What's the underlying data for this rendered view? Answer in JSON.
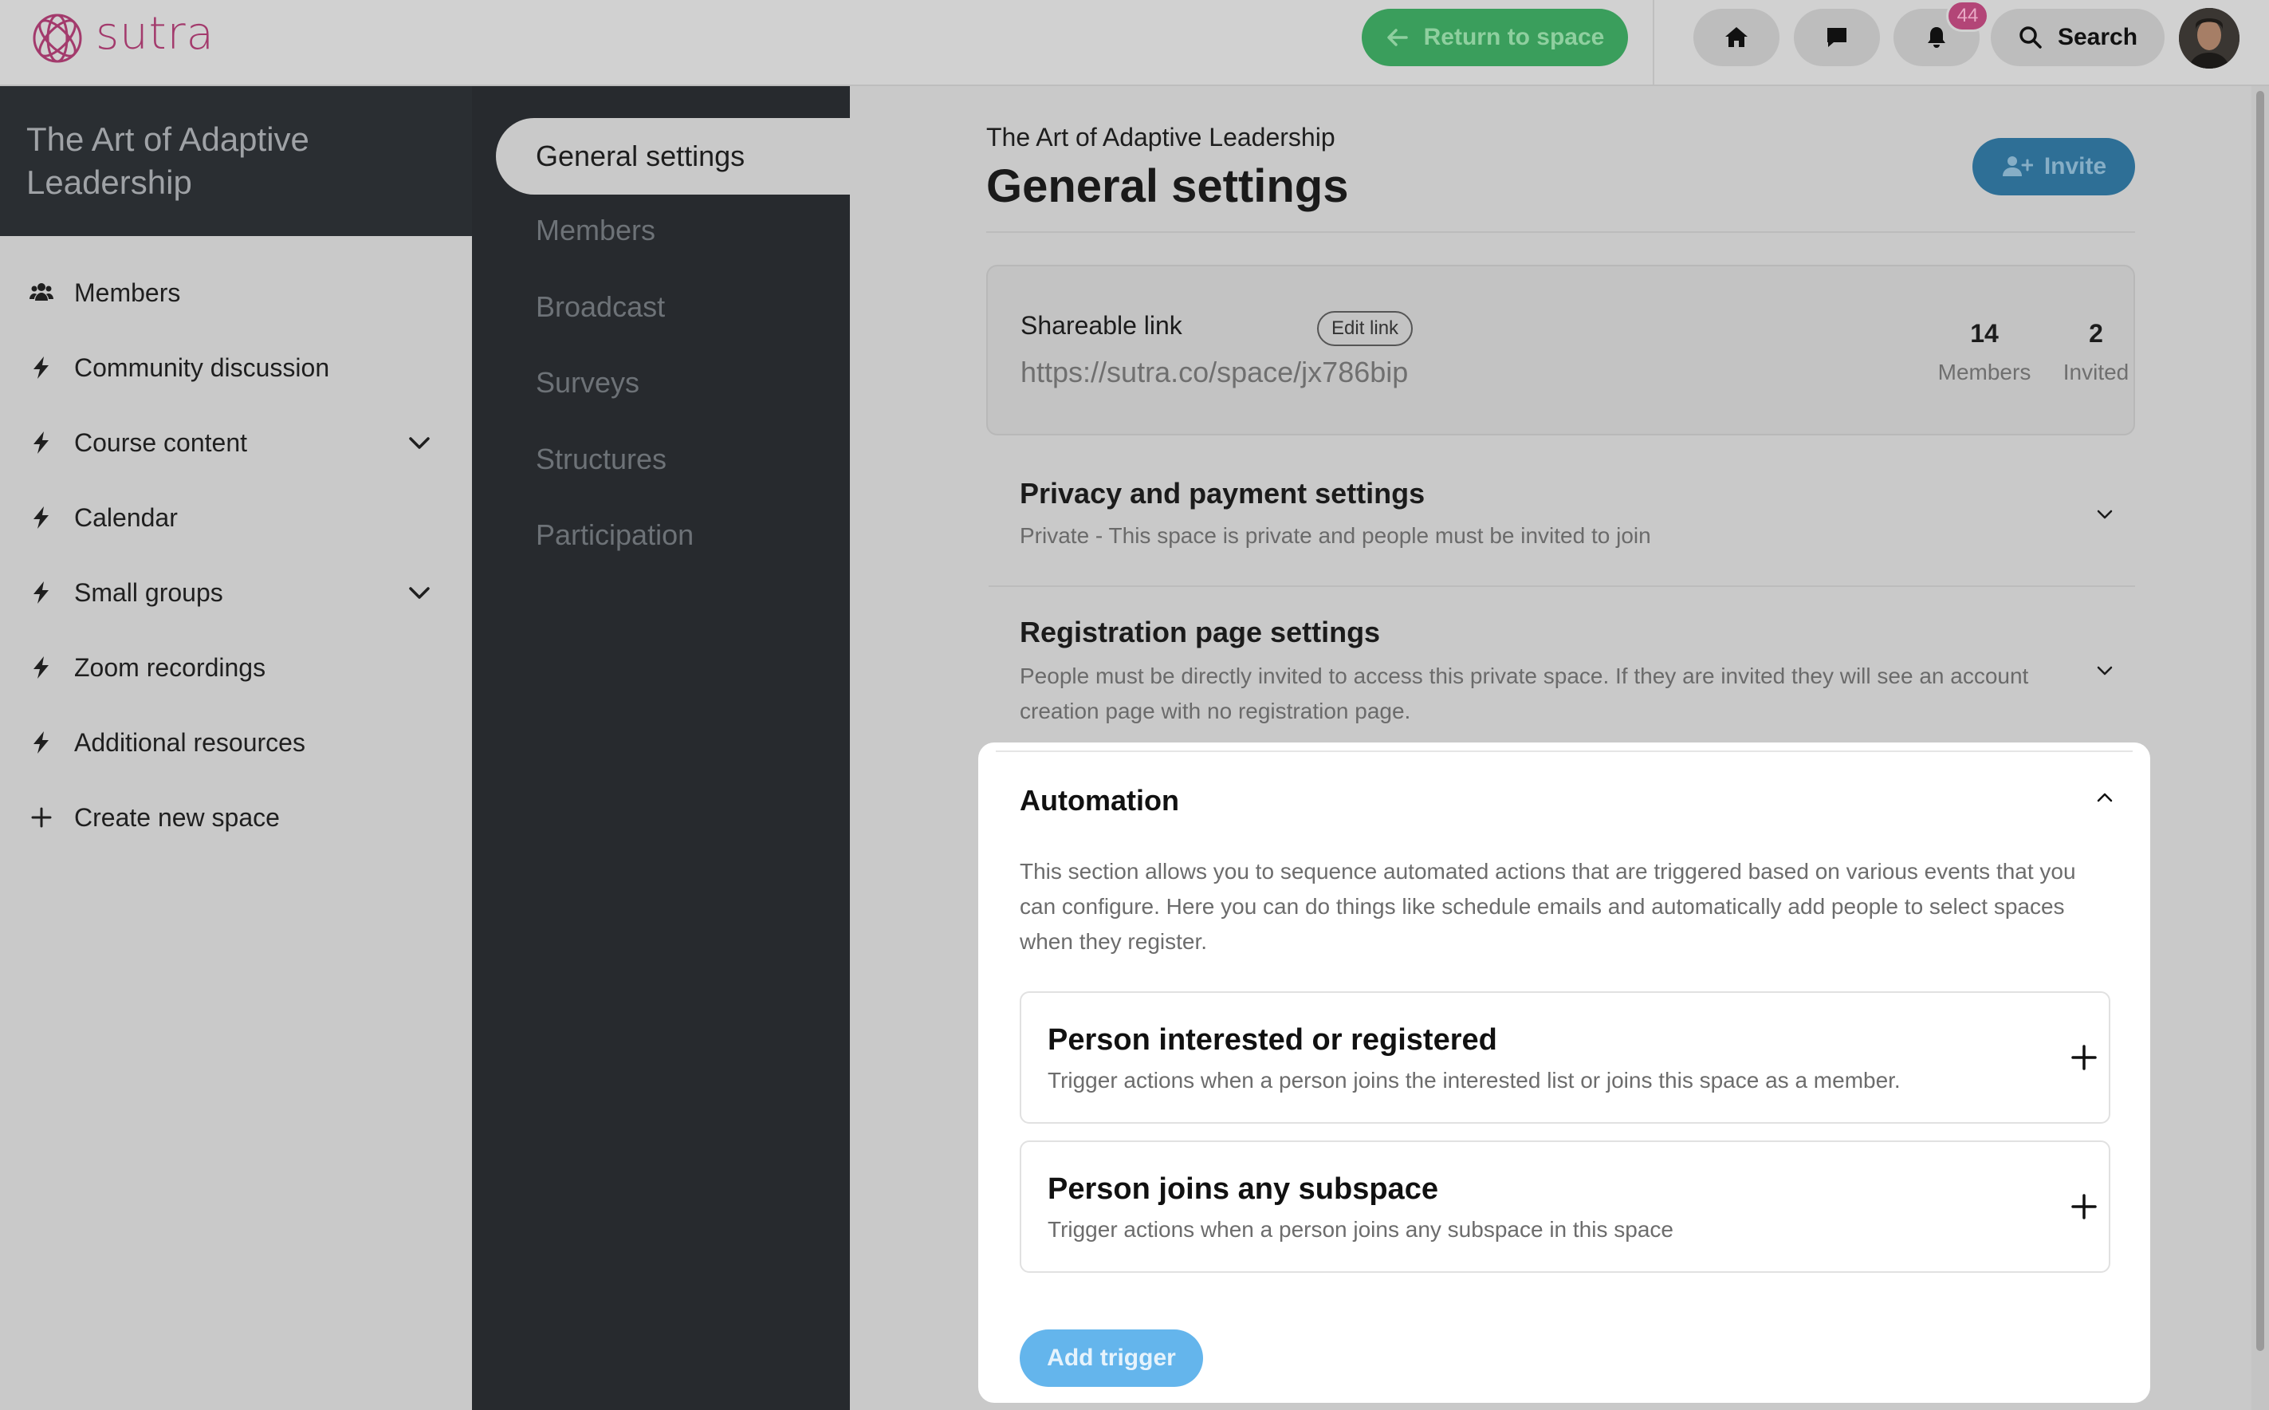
{
  "app": {
    "brand": "sutra",
    "brand_color": "#a33a6c"
  },
  "topbar": {
    "return_label": "Return to space",
    "notifications_count": "44",
    "search_label": "Search",
    "icons": [
      "home-icon",
      "chat-icon",
      "bell-icon",
      "search-icon"
    ]
  },
  "sidebar": {
    "space_title": "The Art of Adaptive Leadership",
    "items": [
      {
        "label": "Members",
        "icon": "members-icon",
        "expandable": false
      },
      {
        "label": "Community discussion",
        "icon": "bolt-icon",
        "expandable": false
      },
      {
        "label": "Course content",
        "icon": "bolt-icon",
        "expandable": true
      },
      {
        "label": "Calendar",
        "icon": "bolt-icon",
        "expandable": false
      },
      {
        "label": "Small groups",
        "icon": "bolt-icon",
        "expandable": true
      },
      {
        "label": "Zoom recordings",
        "icon": "bolt-icon",
        "expandable": false
      },
      {
        "label": "Additional resources",
        "icon": "bolt-icon",
        "expandable": false
      },
      {
        "label": "Create new space",
        "icon": "plus-icon",
        "expandable": false
      }
    ]
  },
  "settings_nav": {
    "active": "General settings",
    "items": [
      "General settings",
      "Members",
      "Broadcast",
      "Surveys",
      "Structures",
      "Participation"
    ]
  },
  "main": {
    "breadcrumb": "The Art of Adaptive Leadership",
    "title": "General settings",
    "invite_label": "Invite",
    "share": {
      "label": "Shareable link",
      "edit_label": "Edit link",
      "url": "https://sutra.co/space/jx786bip",
      "members_count": "14",
      "members_label": "Members",
      "invited_count": "2",
      "invited_label": "Invited"
    },
    "privacy": {
      "title": "Privacy and payment settings",
      "desc": "Private - This space is private and people must be invited to join"
    },
    "registration": {
      "title": "Registration page settings",
      "desc": "People must be directly invited to access this private space. If they are invited they will see an account creation page with no registration page."
    },
    "automation": {
      "title": "Automation",
      "desc": "This section allows you to sequence automated actions that are triggered based on various events that you can configure. Here you can do things like schedule emails and automatically add people to select spaces when they register.",
      "triggers": [
        {
          "title": "Person interested or registered",
          "desc": "Trigger actions when a person joins the interested list or joins this space as a member."
        },
        {
          "title": "Person joins any subspace",
          "desc": "Trigger actions when a person joins any subspace in this space"
        }
      ],
      "add_label": "Add trigger"
    }
  },
  "colors": {
    "return_button": "#3a9e5c",
    "invite_button": "#2e6f96",
    "add_trigger_button": "#64b5ec",
    "badge": "#b34577",
    "sidebar_dark": "#272a2e"
  }
}
